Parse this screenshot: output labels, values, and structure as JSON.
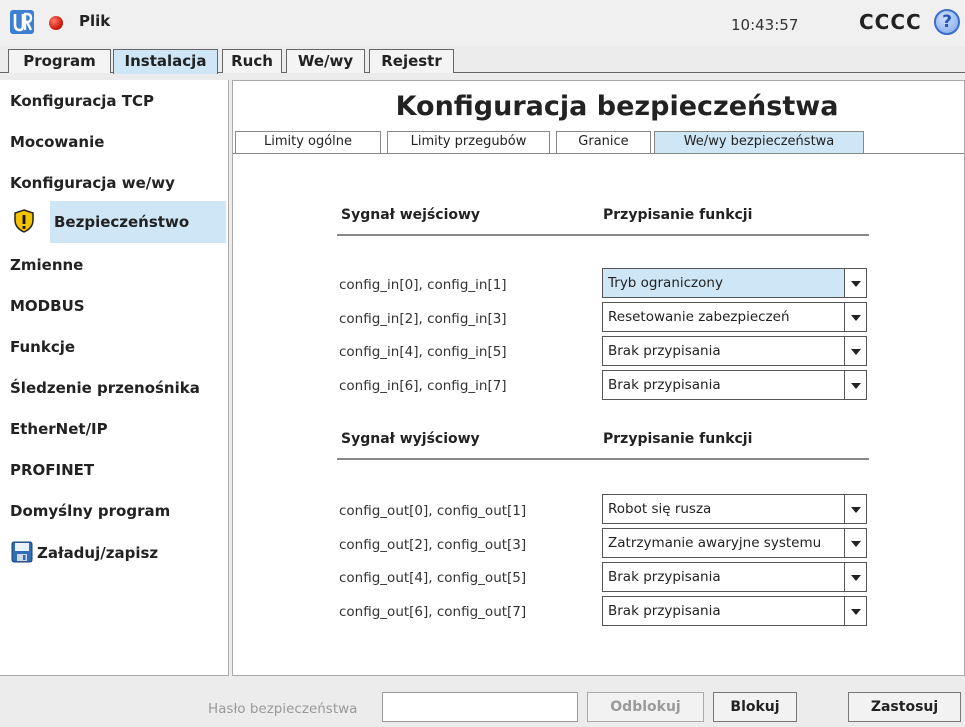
{
  "header": {
    "menu_label": "Plik",
    "clock": "10:43:57",
    "robot_name": "CCCC",
    "help_label": "?"
  },
  "main_tabs": [
    {
      "label": "Program"
    },
    {
      "label": "Instalacja"
    },
    {
      "label": "Ruch"
    },
    {
      "label": "We/wy"
    },
    {
      "label": "Rejestr"
    }
  ],
  "sidebar": {
    "items": [
      {
        "label": "Konfiguracja TCP"
      },
      {
        "label": "Mocowanie"
      },
      {
        "label": "Konfiguracja we/wy"
      },
      {
        "label": "Bezpieczeństwo",
        "icon": "warning-shield-icon"
      },
      {
        "label": "Zmienne"
      },
      {
        "label": "MODBUS"
      },
      {
        "label": "Funkcje"
      },
      {
        "label": "Śledzenie przenośnika"
      },
      {
        "label": "EtherNet/IP"
      },
      {
        "label": "PROFINET"
      },
      {
        "label": "Domyślny program"
      },
      {
        "label": "Załaduj/zapisz",
        "icon": "floppy-disk-icon"
      }
    ]
  },
  "page": {
    "title": "Konfiguracja bezpieczeństwa",
    "sub_tabs": [
      {
        "label": "Limity ogólne"
      },
      {
        "label": "Limity przegubów"
      },
      {
        "label": "Granice"
      },
      {
        "label": "We/wy bezpieczeństwa"
      }
    ]
  },
  "inputs_section": {
    "signal_header": "Sygnał wejściowy",
    "function_header": "Przypisanie funkcji",
    "rows": [
      {
        "signal": "config_in[0], config_in[1]",
        "function": "Tryb ograniczony"
      },
      {
        "signal": "config_in[2], config_in[3]",
        "function": "Resetowanie zabezpieczeń"
      },
      {
        "signal": "config_in[4], config_in[5]",
        "function": "Brak przypisania"
      },
      {
        "signal": "config_in[6], config_in[7]",
        "function": "Brak przypisania"
      }
    ]
  },
  "outputs_section": {
    "signal_header": "Sygnał wyjściowy",
    "function_header": "Przypisanie funkcji",
    "rows": [
      {
        "signal": "config_out[0], config_out[1]",
        "function": "Robot się rusza"
      },
      {
        "signal": "config_out[2], config_out[3]",
        "function": "Zatrzymanie awaryjne systemu"
      },
      {
        "signal": "config_out[4], config_out[5]",
        "function": "Brak przypisania"
      },
      {
        "signal": "config_out[6], config_out[7]",
        "function": "Brak przypisania"
      }
    ]
  },
  "footer": {
    "password_label": "Hasło bezpieczeństwa",
    "password_value": "",
    "unlock_label": "Odblokuj",
    "lock_label": "Blokuj",
    "apply_label": "Zastosuj"
  },
  "colors": {
    "selection": "#cfe6f7",
    "record_dot": "#d01e12",
    "help_blue": "#3a6ec9"
  }
}
